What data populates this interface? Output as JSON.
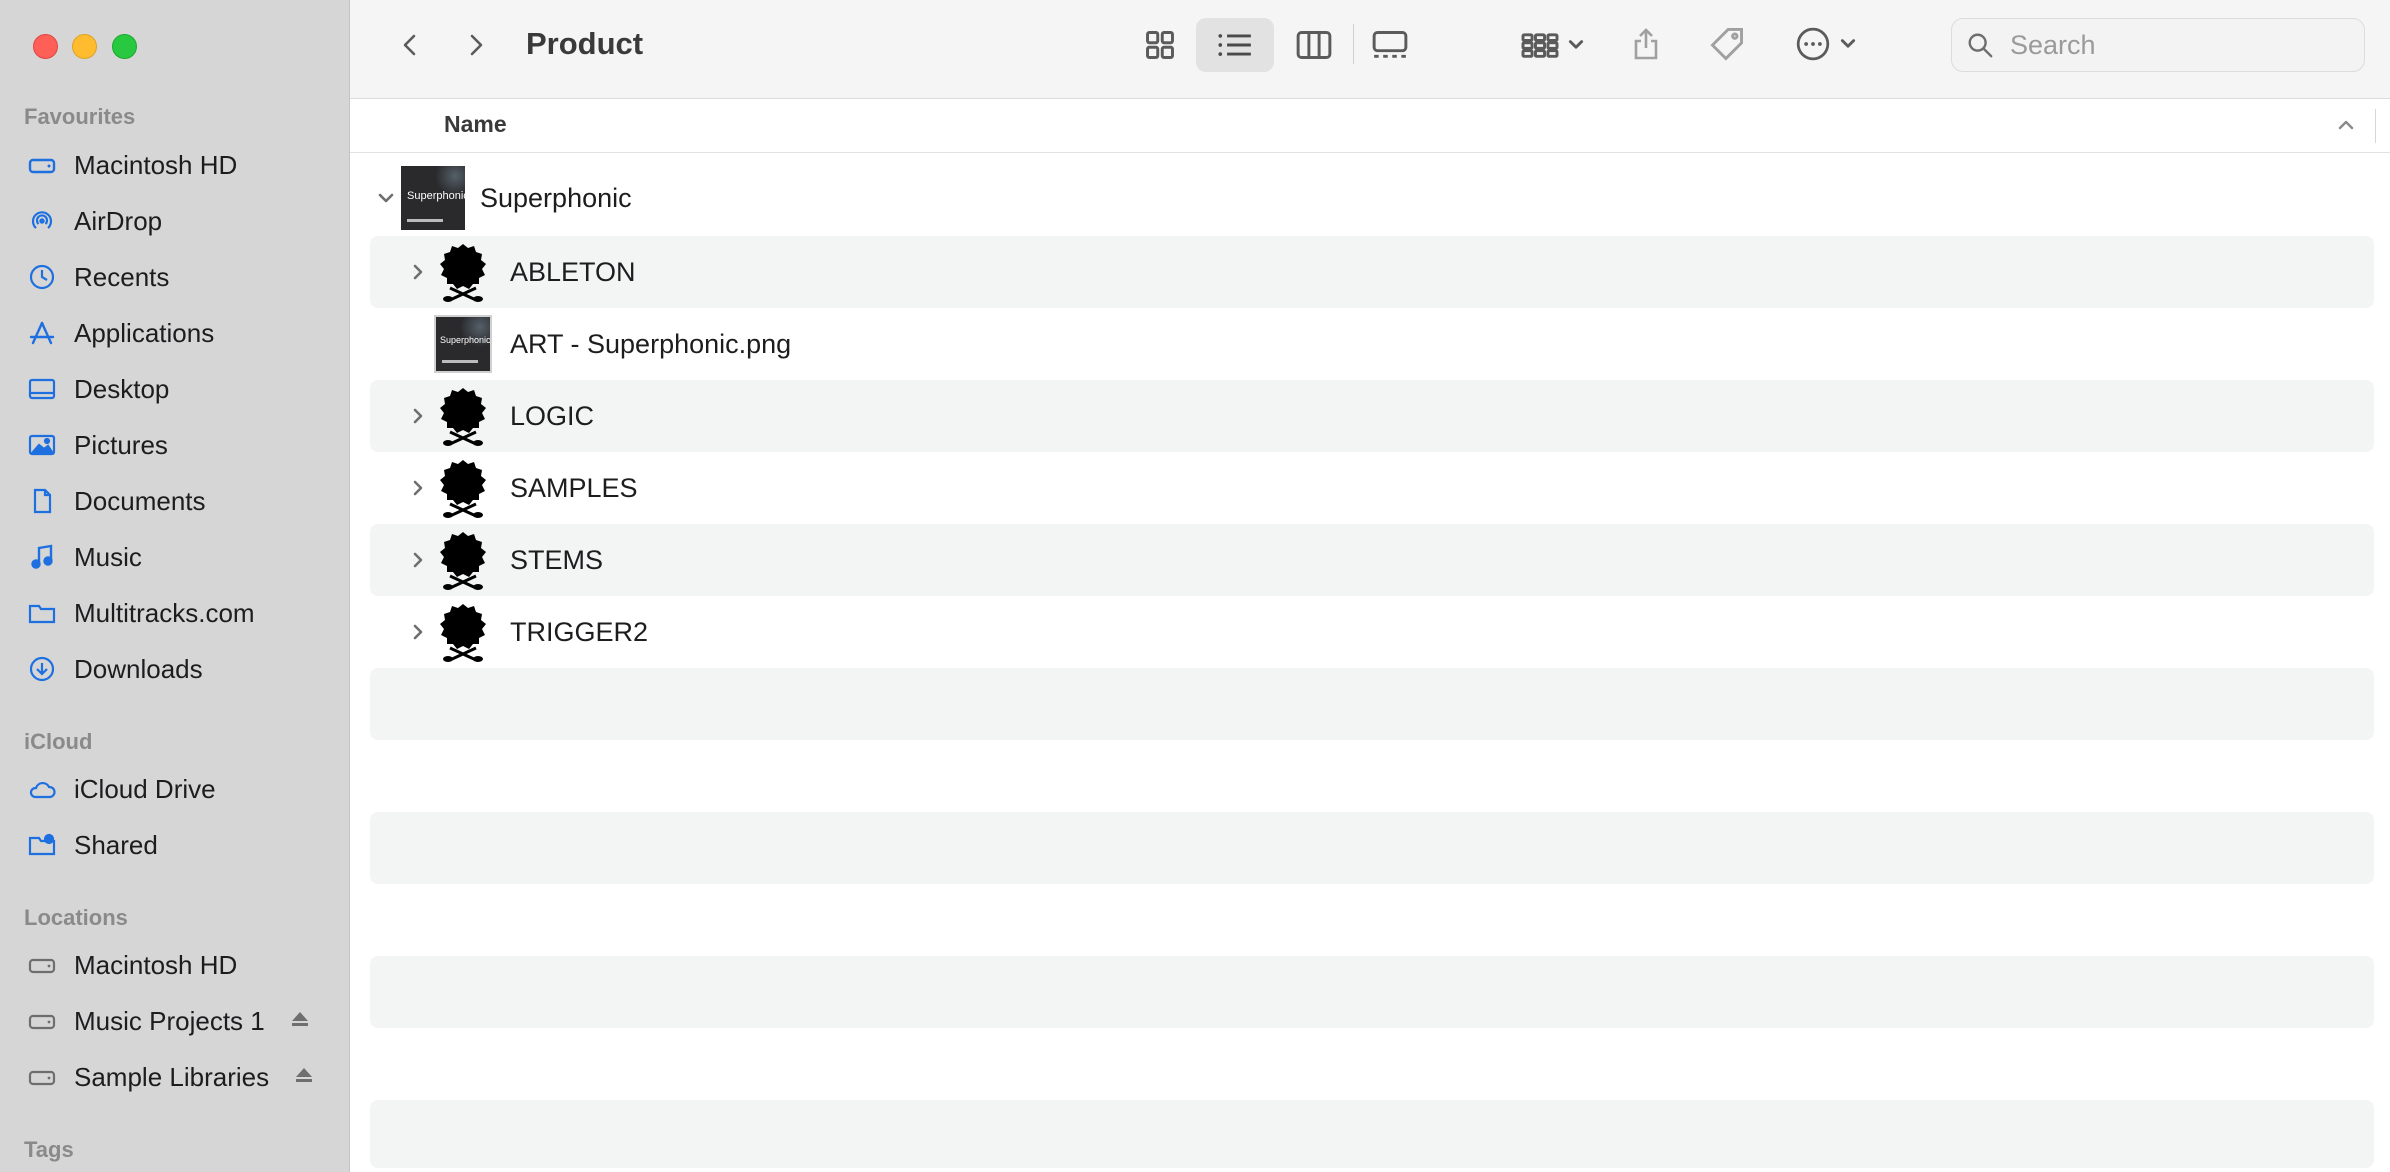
{
  "window": {
    "title": "Product"
  },
  "sidebar": {
    "sections": [
      {
        "heading": "Favourites",
        "items": [
          {
            "label": "Macintosh HD",
            "icon": "hard-drive-icon"
          },
          {
            "label": "AirDrop",
            "icon": "airdrop-icon"
          },
          {
            "label": "Recents",
            "icon": "clock-icon"
          },
          {
            "label": "Applications",
            "icon": "applications-icon"
          },
          {
            "label": "Desktop",
            "icon": "desktop-icon"
          },
          {
            "label": "Pictures",
            "icon": "photo-icon"
          },
          {
            "label": "Documents",
            "icon": "document-icon"
          },
          {
            "label": "Music",
            "icon": "music-note-icon"
          },
          {
            "label": "Multitracks.com",
            "icon": "folder-icon"
          },
          {
            "label": "Downloads",
            "icon": "download-icon"
          }
        ]
      },
      {
        "heading": "iCloud",
        "items": [
          {
            "label": "iCloud Drive",
            "icon": "cloud-icon"
          },
          {
            "label": "Shared",
            "icon": "shared-folder-icon"
          }
        ]
      },
      {
        "heading": "Locations",
        "items": [
          {
            "label": "Macintosh HD",
            "icon": "hard-drive-icon"
          },
          {
            "label": "Music Projects 1",
            "icon": "external-drive-icon",
            "eject": true
          },
          {
            "label": "Sample Libraries",
            "icon": "external-drive-icon",
            "eject": true
          }
        ]
      },
      {
        "heading": "Tags",
        "items": []
      }
    ]
  },
  "toolbar": {
    "search_placeholder": "Search",
    "view_mode": "list",
    "colors": {
      "accent": "#1e6fe0"
    }
  },
  "columns": {
    "name_header": "Name"
  },
  "files": [
    {
      "name": "Superphonic",
      "kind": "folder-cover",
      "expanded": true,
      "level": 0
    },
    {
      "name": "ABLETON",
      "kind": "custom-folder",
      "expanded": false,
      "level": 1
    },
    {
      "name": "ART - Superphonic.png",
      "kind": "image",
      "level": 1
    },
    {
      "name": "LOGIC",
      "kind": "custom-folder",
      "expanded": false,
      "level": 1
    },
    {
      "name": "SAMPLES",
      "kind": "custom-folder",
      "expanded": false,
      "level": 1
    },
    {
      "name": "STEMS",
      "kind": "custom-folder",
      "expanded": false,
      "level": 1
    },
    {
      "name": "TRIGGER2",
      "kind": "custom-folder",
      "expanded": false,
      "level": 1
    }
  ],
  "cover_art": {
    "text": "Superphonic"
  }
}
